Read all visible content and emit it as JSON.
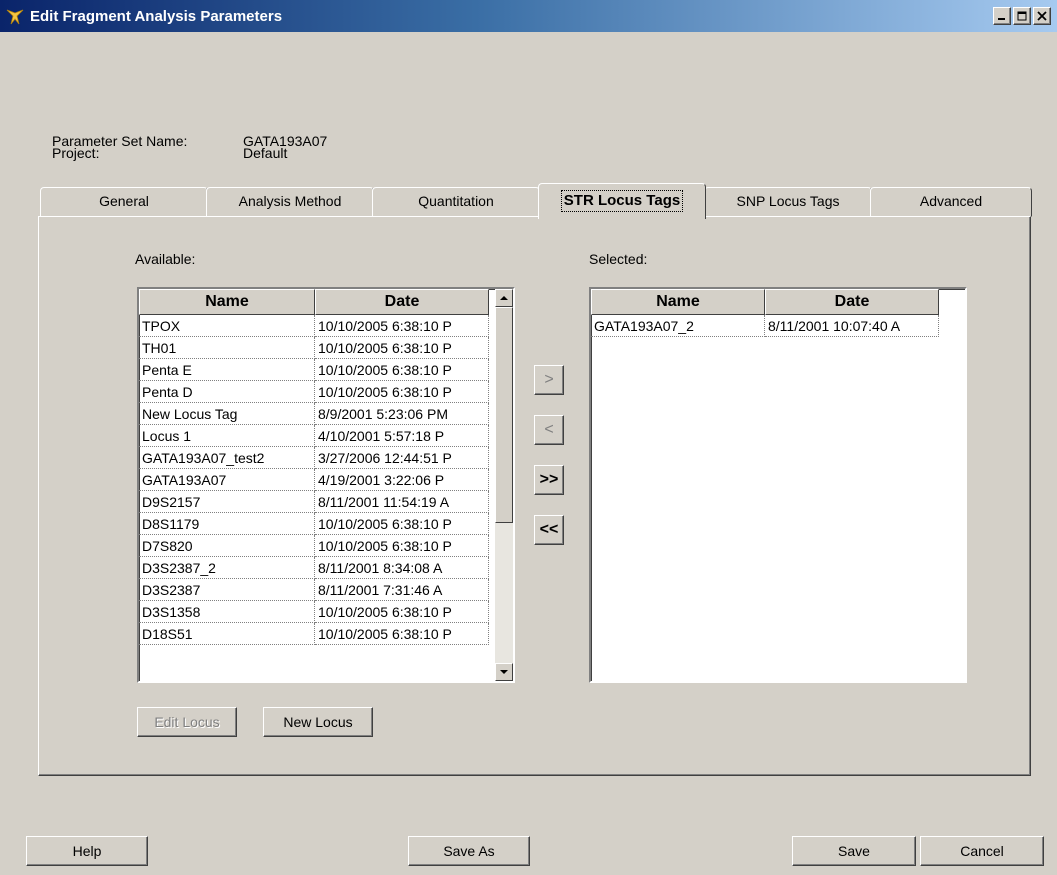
{
  "window": {
    "title": "Edit Fragment Analysis Parameters"
  },
  "fields": {
    "param_set_label": "Parameter Set Name:",
    "param_set_value": "GATA193A07",
    "project_label": "Project:",
    "project_value": "Default"
  },
  "tabs": [
    {
      "label": "General",
      "active": false
    },
    {
      "label": "Analysis Method",
      "active": false
    },
    {
      "label": "Quantitation",
      "active": false
    },
    {
      "label": "STR Locus Tags",
      "active": true
    },
    {
      "label": "SNP Locus Tags",
      "active": false
    },
    {
      "label": "Advanced",
      "active": false
    }
  ],
  "available": {
    "label": "Available:",
    "columns": [
      "Name",
      "Date"
    ],
    "rows": [
      [
        "TPOX",
        "10/10/2005 6:38:10 P"
      ],
      [
        "TH01",
        "10/10/2005 6:38:10 P"
      ],
      [
        "Penta E",
        "10/10/2005 6:38:10 P"
      ],
      [
        "Penta D",
        "10/10/2005 6:38:10 P"
      ],
      [
        "New Locus Tag",
        "8/9/2001 5:23:06 PM"
      ],
      [
        "Locus 1",
        "4/10/2001 5:57:18 P"
      ],
      [
        "GATA193A07_test2",
        "3/27/2006 12:44:51 P"
      ],
      [
        "GATA193A07",
        "4/19/2001 3:22:06 P"
      ],
      [
        "D9S2157",
        "8/11/2001 11:54:19 A"
      ],
      [
        "D8S1179",
        "10/10/2005 6:38:10 P"
      ],
      [
        "D7S820",
        "10/10/2005 6:38:10 P"
      ],
      [
        "D3S2387_2",
        "8/11/2001 8:34:08 A"
      ],
      [
        "D3S2387",
        "8/11/2001 7:31:46 A"
      ],
      [
        "D3S1358",
        "10/10/2005 6:38:10 P"
      ],
      [
        "D18S51",
        "10/10/2005 6:38:10 P"
      ]
    ]
  },
  "selected": {
    "label": "Selected:",
    "columns": [
      "Name",
      "Date"
    ],
    "rows": [
      [
        "GATA193A07_2",
        "8/11/2001 10:07:40 A"
      ]
    ]
  },
  "move_buttons": {
    "add": ">",
    "remove": "<",
    "add_all": ">>",
    "remove_all": "<<"
  },
  "locus_buttons": {
    "edit": "Edit Locus",
    "new": "New Locus"
  },
  "footer": {
    "help": "Help",
    "save_as": "Save As",
    "save": "Save",
    "cancel": "Cancel"
  }
}
